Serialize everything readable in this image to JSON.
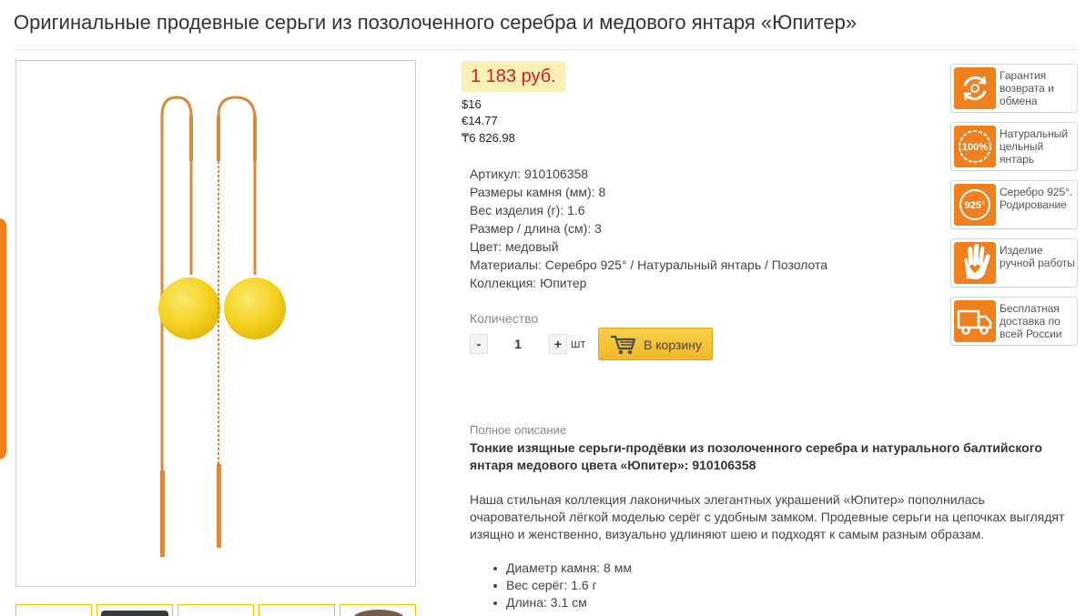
{
  "title": "Оригинальные продевные серьги из позолоченного серебра и медового янтаря «Юпитер»",
  "price": {
    "main": "1 183 руб.",
    "usd": "$16",
    "eur": "€14.77",
    "kzt": "₸6 826.98"
  },
  "specs": [
    "Артикул: 910106358",
    "Размеры камня (мм): 8",
    "Вес изделия (г): 1.6",
    "Размер / длина (см): 3",
    "Цвет: медовый",
    "Материалы: Серебро 925° / Натуральный янтарь / Позолота",
    "Коллекция: Юпитер"
  ],
  "quantity": {
    "label": "Количество",
    "minus": "-",
    "plus": "+",
    "value": "1",
    "unit": "шт",
    "cart_button": "В корзину"
  },
  "description": {
    "heading": "Полное описание",
    "lead": "Тонкие изящные серьги-продёвки из позолоченного серебра и натурального балтийского янтаря медового цвета «Юпитер»: 910106358",
    "body": "Наша стильная коллекция лаконичных элегантных украшений «Юпитер» пополнилась очаровательной лёгкой моделью серёг с удобным замком. Продевные серьги на цепочках выглядят изящно и женственно, визуально удлиняют шею и подходят к самым разным образам.",
    "bullets": [
      "Диаметр камня: 8 мм",
      "Вес серёг: 1.6 г",
      "Длина: 3.1 см"
    ]
  },
  "benefits": [
    {
      "icon": "return-exchange-icon",
      "text": "Гарантия возврата и обмена"
    },
    {
      "icon": "natural-amber-100-icon",
      "text": "Натуральный цельный янтарь",
      "badge": "100%"
    },
    {
      "icon": "silver-925-icon",
      "text": "Серебро 925°. Родирование",
      "badge": "925°"
    },
    {
      "icon": "handmade-hand-icon",
      "text": "Изделие ручной работы"
    },
    {
      "icon": "delivery-truck-icon",
      "text": "Бесплатная доставка по всей России"
    }
  ],
  "colors": {
    "price_text": "#d11f13",
    "price_bg": "#fbf1b6",
    "accent_orange": "#f07f1e",
    "button": "#f5c23a",
    "amber": "#f4d21f",
    "gold": "#d98a3a"
  }
}
